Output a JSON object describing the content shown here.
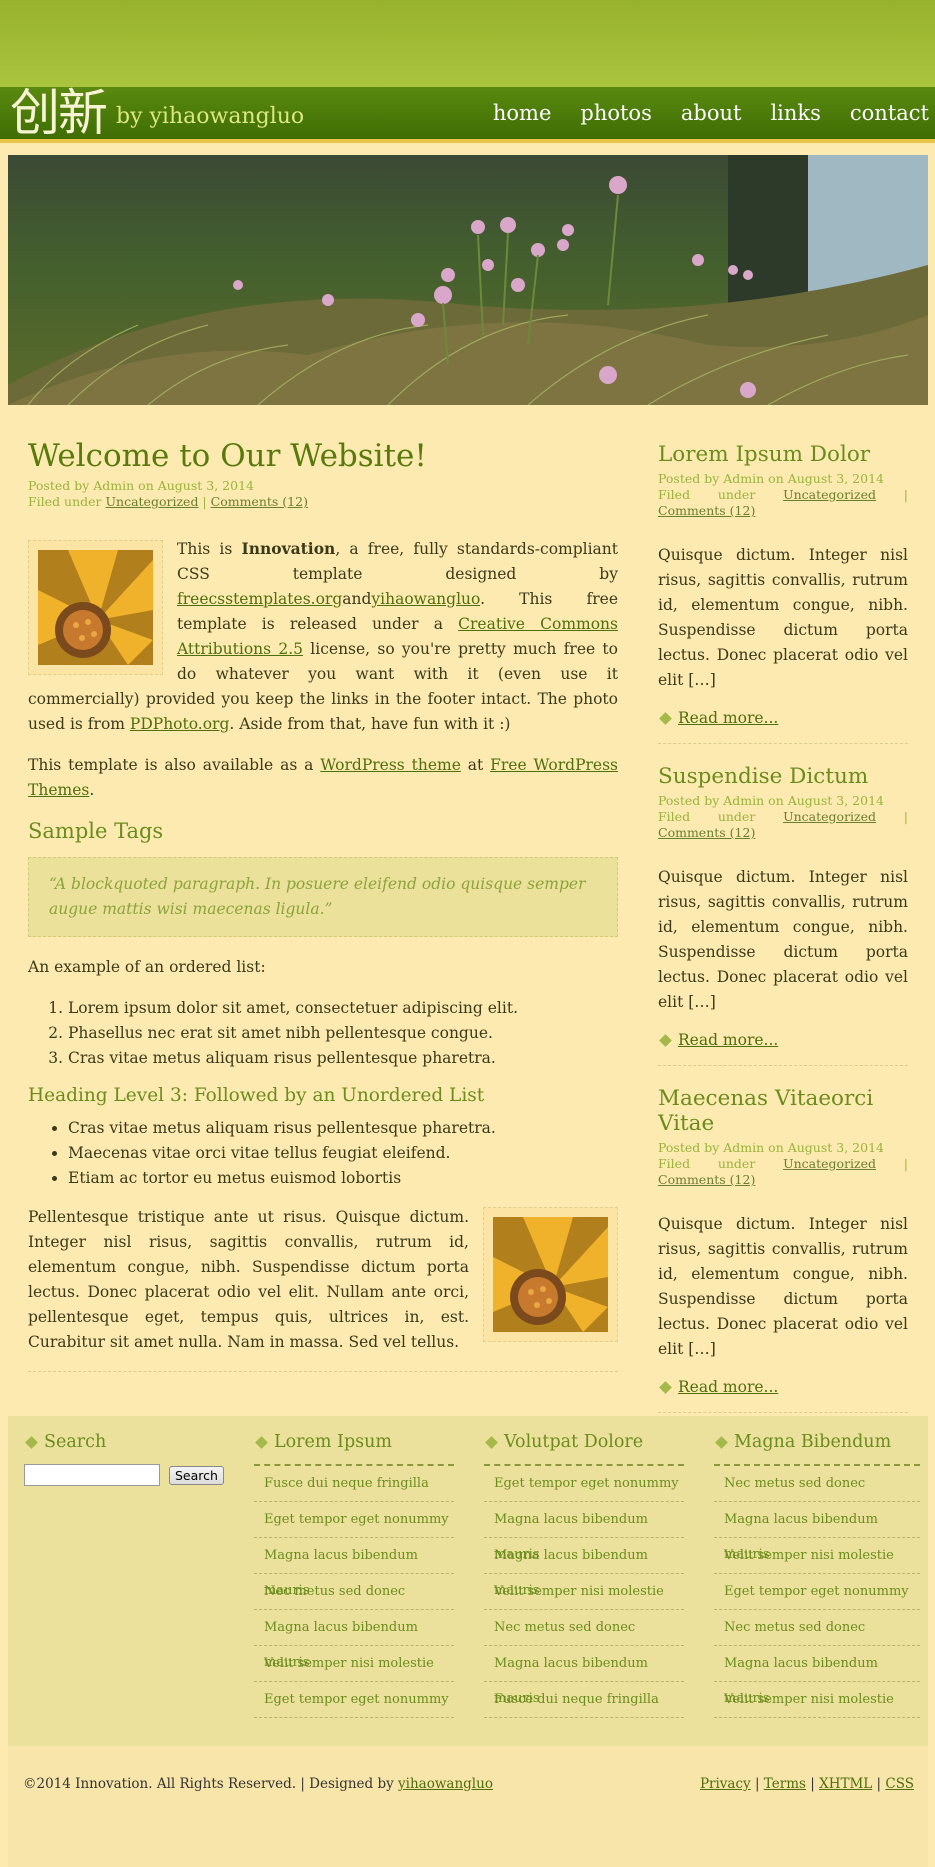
{
  "header": {
    "logo_cn": "创新",
    "logo_by": "by yihaowangluo",
    "nav": [
      "home",
      "photos",
      "about",
      "links",
      "contact"
    ]
  },
  "main": {
    "title": "Welcome to Our Website!",
    "meta_posted": "Posted by Admin on August 3, 2014",
    "meta_filed": "Filed under ",
    "meta_cat": "Uncategorized",
    "meta_sep": " | ",
    "meta_comments": "Comments (12)",
    "p1": {
      "a": "This is ",
      "b": "Innovation",
      "c": ", a free, fully standards-compliant CSS template designed by ",
      "d": "freecsstemplates.org",
      "e": "and",
      "f": "yihaowangluo",
      "g": ". This free template is released under a ",
      "h": "Creative Commons Attributions 2.5",
      "i": " license, so you're pretty much free to do whatever you want with it (even use it commercially) provided you keep the links in the footer intact. The photo used is from ",
      "j": "PDPhoto.org",
      "k": ". Aside from that, have fun with it :)"
    },
    "p2": {
      "a": "This template is also available as a ",
      "b": "WordPress theme",
      "c": " at ",
      "d": "Free WordPress Themes",
      "e": "."
    },
    "sample_tags": "Sample Tags",
    "blockquote": "“A blockquoted paragraph. In posuere eleifend odio quisque semper augue mattis wisi maecenas ligula.”",
    "ordered_intro": "An example of an ordered list:",
    "ordered": [
      "Lorem ipsum dolor sit amet, consectetuer adipiscing elit.",
      "Phasellus nec erat sit amet nibh pellentesque congue.",
      "Cras vitae metus aliquam risus pellentesque pharetra."
    ],
    "h3": "Heading Level 3: Followed by an Unordered List",
    "unordered": [
      "Cras vitae metus aliquam risus pellentesque pharetra.",
      "Maecenas vitae orci vitae tellus feugiat eleifend.",
      "Etiam ac tortor eu metus euismod lobortis"
    ],
    "p3": "Pellentesque tristique ante ut risus. Quisque dictum. Integer nisl risus, sagittis convallis, rutrum id, elementum congue, nibh. Suspendisse dictum porta lectus. Donec placerat odio vel elit. Nullam ante orci, pellentesque eget, tempus quis, ultrices in, est. Curabitur sit amet nulla. Nam in massa. Sed vel tellus."
  },
  "sidebar": {
    "posts": [
      {
        "title": "Lorem Ipsum Dolor",
        "posted": "Posted by Admin on August 3, 2014",
        "filed": "Filed under ",
        "cat": "Uncategorized",
        "sep": " | ",
        "comments": "Comments (12)",
        "body": "Quisque dictum. Integer nisl risus, sagittis convallis, rutrum id, elementum congue, nibh. Suspendisse dictum porta lectus. Donec placerat odio vel elit […]",
        "more": "Read more..."
      },
      {
        "title": "Suspendise Dictum",
        "posted": "Posted by Admin on August 3, 2014",
        "filed": "Filed under ",
        "cat": "Uncategorized",
        "sep": " | ",
        "comments": "Comments (12)",
        "body": "Quisque dictum. Integer nisl risus, sagittis convallis, rutrum id, elementum congue, nibh. Suspendisse dictum porta lectus. Donec placerat odio vel elit […]",
        "more": "Read more..."
      },
      {
        "title": "Maecenas Vitaeorci Vitae",
        "posted": "Posted by Admin on August 3, 2014",
        "filed": "Filed under ",
        "cat": "Uncategorized",
        "sep": " | ",
        "comments": "Comments (12)",
        "body": "Quisque dictum. Integer nisl risus, sagittis convallis, rutrum id, elementum congue, nibh. Suspendisse dictum porta lectus. Donec placerat odio vel elit […]",
        "more": "Read more..."
      }
    ]
  },
  "footer": {
    "search_title": "Search",
    "search_value": "",
    "search_button": "Search",
    "col1": {
      "title": "Lorem Ipsum",
      "items": [
        "Fusce dui neque fringilla",
        "Eget tempor eget nonummy",
        "Magna lacus bibendum mauris",
        "Nec metus sed donec",
        "Magna lacus bibendum mauris",
        "Velit semper nisi molestie",
        "Eget tempor eget nonummy"
      ]
    },
    "col2": {
      "title": "Volutpat Dolore",
      "items": [
        "Eget tempor eget nonummy",
        "Magna lacus bibendum mauris",
        "Magna lacus bibendum mauris",
        "Velit semper nisi molestie",
        "Nec metus sed donec",
        "Magna lacus bibendum mauris",
        "Fusce dui neque fringilla"
      ]
    },
    "col3": {
      "title": "Magna Bibendum",
      "items": [
        "Nec metus sed donec",
        "Magna lacus bibendum mauris",
        "Velit semper nisi molestie",
        "Eget tempor eget nonummy",
        "Nec metus sed donec",
        "Magna lacus bibendum mauris",
        "Velit semper nisi molestie"
      ]
    },
    "copyright": "©2014 Innovation. All Rights Reserved. | Designed by ",
    "designer": "yihaowangluo",
    "links": [
      "Privacy",
      "Terms",
      "XHTML",
      "CSS"
    ],
    "link_sep": " | "
  }
}
